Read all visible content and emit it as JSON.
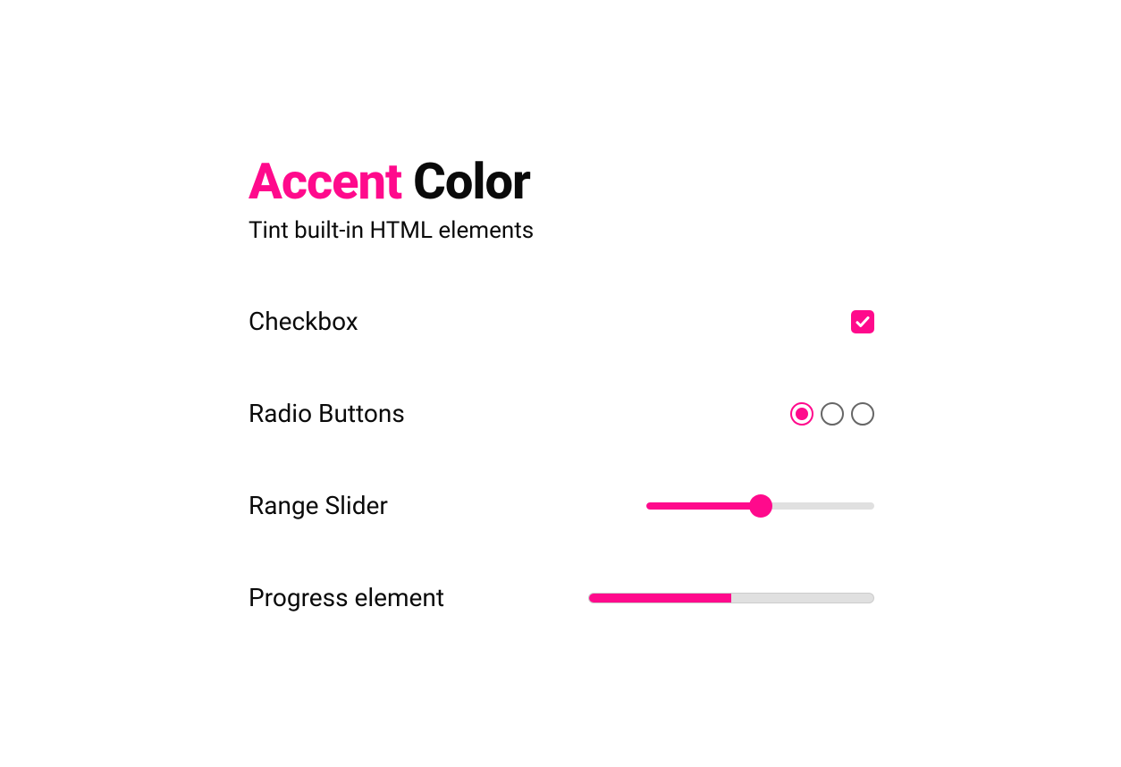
{
  "accent_color": "#ff0a8c",
  "heading": {
    "word1": "Accent",
    "word2": "Color"
  },
  "subtitle": "Tint built-in HTML elements",
  "rows": {
    "checkbox": {
      "label": "Checkbox",
      "checked": true
    },
    "radio": {
      "label": "Radio Buttons",
      "count": 3,
      "selected_index": 0
    },
    "range": {
      "label": "Range Slider",
      "value": 50,
      "min": 0,
      "max": 100
    },
    "progress": {
      "label": "Progress element",
      "value": 50,
      "max": 100
    }
  }
}
